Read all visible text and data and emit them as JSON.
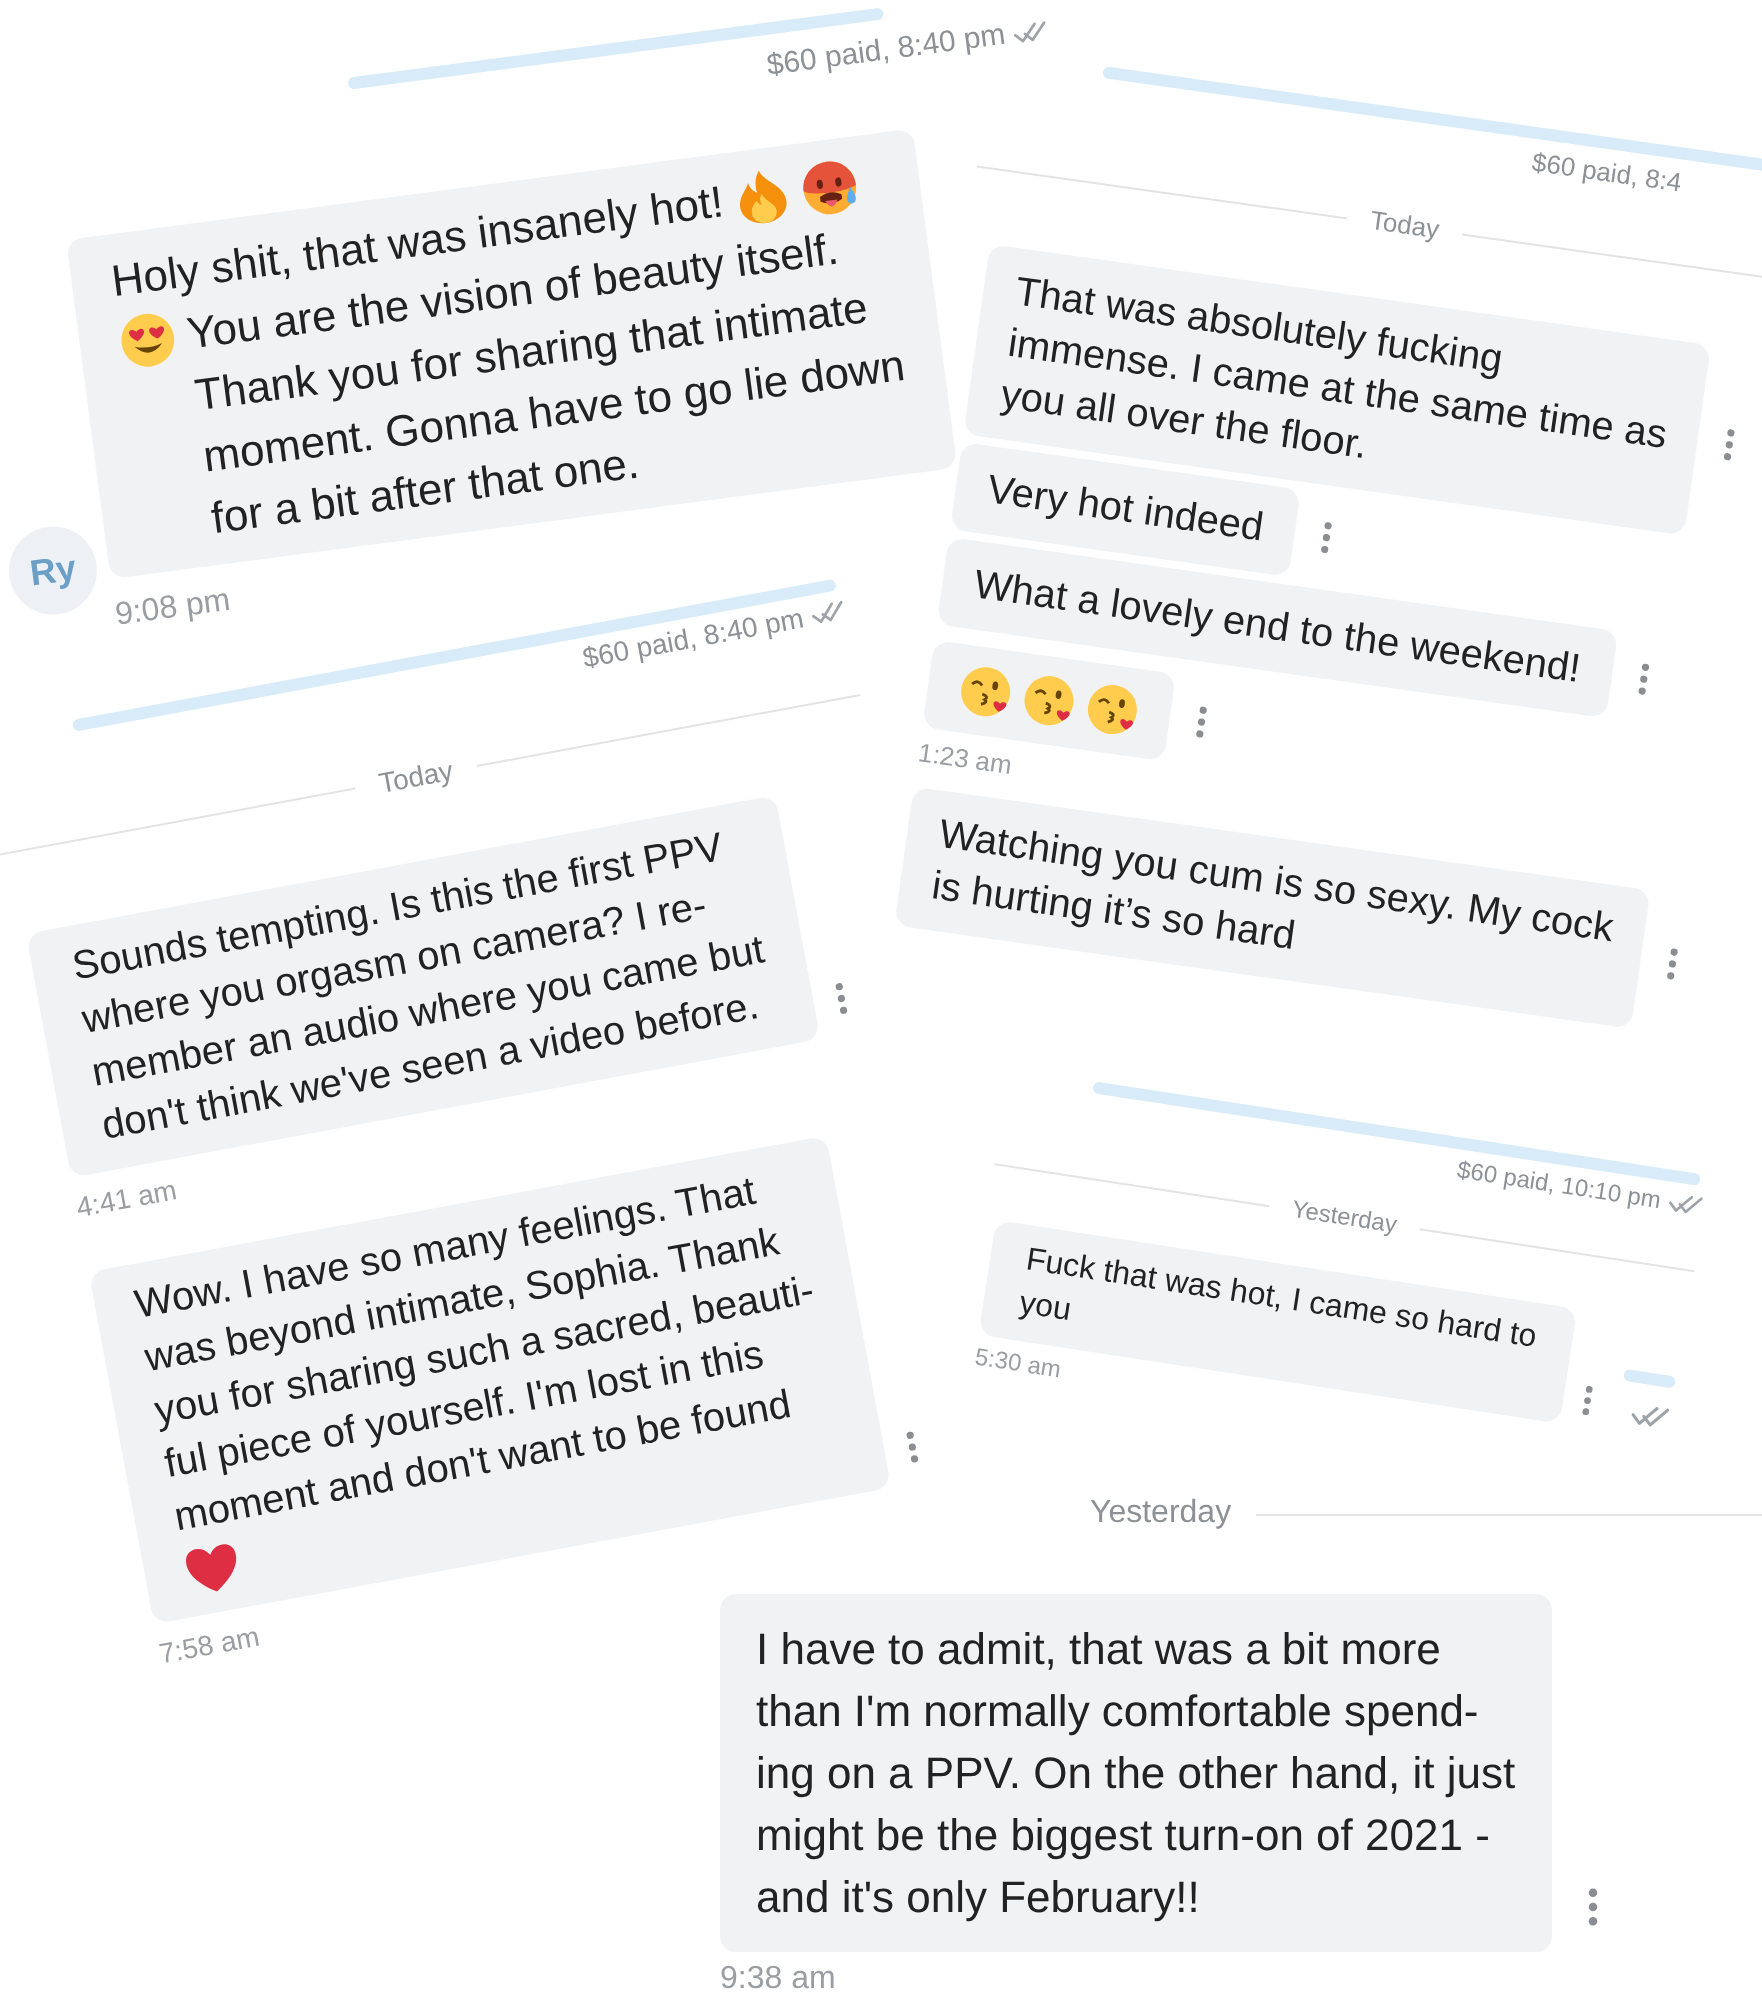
{
  "fragments": [
    {
      "payment": {
        "text": "$60 paid, 8:40 pm",
        "read": true
      },
      "messages": [
        {
          "avatar": "Ry",
          "parts": [
            {
              "kind": "text",
              "text": "Holy shit, that was insanely hot!"
            },
            {
              "kind": "emoji"
            },
            {
              "kind": "emoji"
            },
            {
              "kind": "break"
            },
            {
              "kind": "emoji"
            },
            {
              "kind": "text",
              "text": "You are the vision of beauty itself.\nThank you for sharing that intimate\nmoment. Gonna have to go lie down\nfor a bit after that one."
            }
          ],
          "time": "9:08 pm"
        }
      ]
    },
    {
      "payment": {
        "text": "$60 paid, 8:40 pm",
        "read": true
      },
      "date": "Today",
      "messages": [
        {
          "text": "Sounds tempting. Is this the first PPV\nwhere you orgasm on camera? I re-\nmember an audio where you came but\ndon't think we've seen a video before.",
          "time": "4:41 am",
          "more_button": true
        },
        {
          "parts": [
            {
              "kind": "text",
              "text": "Wow. I have so many feelings. That\nwas beyond intimate, Sophia. Thank\nyou for sharing such a sacred, beauti-\nful piece of yourself. I'm lost in this\nmoment and don't want to be found"
            },
            {
              "kind": "break"
            },
            {
              "kind": "emoji"
            }
          ],
          "time": "7:58 am",
          "more_button": true
        }
      ]
    },
    {
      "payment": {
        "text": "$60 paid, 8:4"
      },
      "date": "Today",
      "messages": [
        {
          "text": "That was absolutely fucking\nimmense. I came at the same time as\nyou all over the floor.",
          "more_button": true
        },
        {
          "text": "Very hot indeed",
          "more_button": true
        },
        {
          "text": "What a lovely end to the weekend!",
          "more_button": true
        },
        {
          "parts": [
            {
              "kind": "emoji"
            },
            {
              "kind": "emoji"
            },
            {
              "kind": "emoji"
            }
          ],
          "time": "1:23 am",
          "more_button": true
        },
        {
          "text": "Watching you cum is so sexy. My cock\nis hurting it’s so hard",
          "more_button": true
        }
      ]
    },
    {
      "payment": {
        "text": "$60 paid, 10:10 pm",
        "read": true
      },
      "date": "Yesterday",
      "messages": [
        {
          "text": "Fuck that was hot, I came so hard to\nyou",
          "time": "5:30 am",
          "more_button": true
        }
      ],
      "outgoing": {
        "read": true
      }
    },
    {
      "date": "Yesterday",
      "messages": [
        {
          "text": "I have to admit, that was a bit more\nthan I'm normally comfortable spend-\ning on a PPV. On the other hand, it just\nmight be the biggest turn-on of 2021 -\nand it's only February!!",
          "time": "9:38 am",
          "more_button": true
        }
      ]
    }
  ]
}
